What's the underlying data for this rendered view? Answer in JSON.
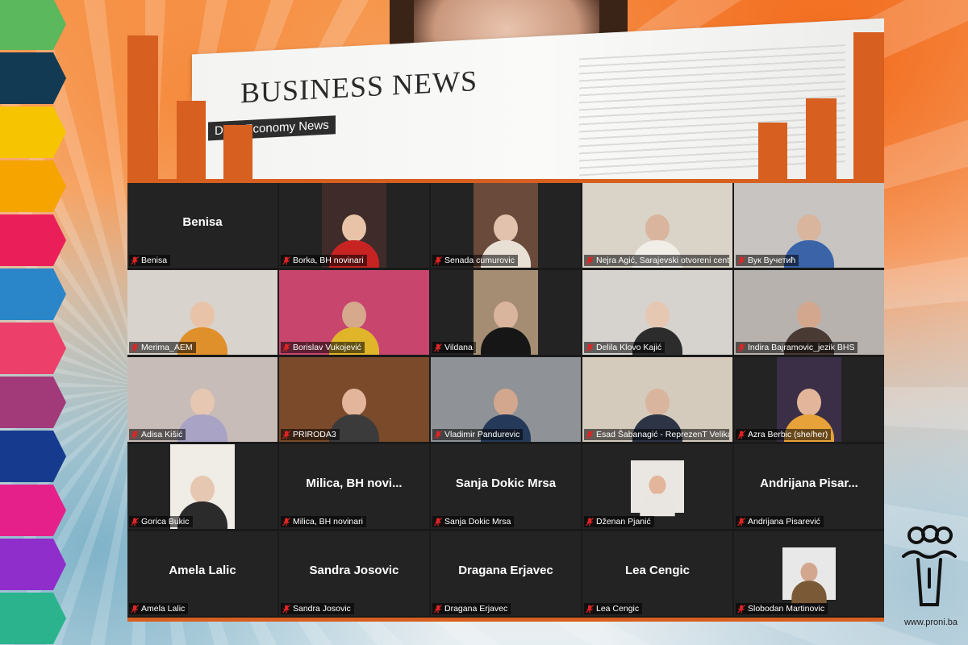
{
  "header": {
    "newspaper_title": "BUSINESS NEWS",
    "newspaper_tag": "Daily Economy News"
  },
  "brand": {
    "url": "www.proni.ba"
  },
  "colors": {
    "accent_orange": "#d75f1f",
    "active_speaker_border": "#c9e36a",
    "arrow_stack": [
      "#5cb85c",
      "#123a52",
      "#f6c400",
      "#f5a400",
      "#ea1f5a",
      "#2a86c8",
      "#ec3f6a",
      "#a23a7a",
      "#163b8e",
      "#e6208a",
      "#8f2ecb",
      "#2bb38e"
    ]
  },
  "participants": [
    {
      "label": "Benisa",
      "display_name": "Benisa",
      "video": false
    },
    {
      "label": "Borka, BH novinari",
      "video": true,
      "bg": "#3f2c2a",
      "shirt": "#c82323",
      "skin": "#e8c3a8"
    },
    {
      "label": "Senada cumurovic",
      "video": true,
      "bg": "#6a4a3a",
      "shirt": "#e8e0d5",
      "skin": "#e2c2ad"
    },
    {
      "label": "Nejra Agić, Sarajevski otvoreni centar",
      "video": true,
      "bg": "#d9d3c8",
      "shirt": "#f1eee8",
      "skin": "#d9b59d"
    },
    {
      "label": "Вук Вучетић",
      "video": true,
      "bg": "#c7c4c1",
      "shirt": "#3a63a8",
      "skin": "#d9b59d"
    },
    {
      "label": "Merima_AEM",
      "video": true,
      "active": true,
      "bg": "#d8d3cc",
      "shirt": "#e0902b",
      "skin": "#e8c3a8"
    },
    {
      "label": "Borislav Vukojević",
      "video": true,
      "bg": "#c8456d",
      "shirt": "#e0b52a",
      "skin": "#d6a88c"
    },
    {
      "label": "Vildana",
      "video": true,
      "bg": "#a58d73",
      "shirt": "#161616",
      "skin": "#d9b59d"
    },
    {
      "label": "Delila Klovo Kajić",
      "video": true,
      "bg": "#d6d3cf",
      "shirt": "#2c2c2c",
      "skin": "#e6c7b1"
    },
    {
      "label": "Indira Bajramovic_jezik BHS",
      "video": true,
      "bg": "#b7b2ae",
      "shirt": "#4a3a34",
      "skin": "#d3a78d"
    },
    {
      "label": "Adisa Kišić",
      "video": true,
      "bg": "#c8bcb8",
      "shirt": "#a9a3c5",
      "skin": "#e6c7b1"
    },
    {
      "label": "PRIRODA3",
      "video": true,
      "bg": "#7a4a2a",
      "shirt": "#3b3b3b",
      "skin": "#e3b59a"
    },
    {
      "label": "Vladimir Pandurevic",
      "video": true,
      "bg": "#8f9296",
      "shirt": "#253a5a",
      "skin": "#d3a78d"
    },
    {
      "label": "Esad Šabanagić - ReprezenT Velika Kladuša",
      "video": true,
      "bg": "#d4cbbd",
      "shirt": "#2c3446",
      "skin": "#d9b59d"
    },
    {
      "label": "Azra Berbic (she/her)",
      "video": true,
      "bg": "#3a2f46",
      "shirt": "#e8a23a",
      "skin": "#e3b59a"
    },
    {
      "label": "Gorica Bukic",
      "video": true,
      "bg": "#f0ece6",
      "shirt": "#2b2b2b",
      "skin": "#e6c7b1"
    },
    {
      "label": "Milica, BH novinari",
      "display_name": "Milica,  BH  novi...",
      "video": false
    },
    {
      "label": "Sanja Dokic Mrsa",
      "display_name": "Sanja Dokic Mrsa",
      "video": false
    },
    {
      "label": "Dženan Pjanić",
      "video": true,
      "bg": "#eae7e3",
      "shirt": "#e9e6e2",
      "skin": "#e3b59a"
    },
    {
      "label": "Andrijana Pisarević",
      "display_name": "Andrijana  Pisar...",
      "video": false
    },
    {
      "label": "Amela Lalic",
      "display_name": "Amela Lalic",
      "video": false
    },
    {
      "label": "Sandra Josovic",
      "display_name": "Sandra Josovic",
      "video": false
    },
    {
      "label": "Dragana Erjavec",
      "display_name": "Dragana Erjavec",
      "video": false
    },
    {
      "label": "Lea Cengic",
      "display_name": "Lea Cengic",
      "video": false
    },
    {
      "label": "Slobodan Martinovic",
      "video": true,
      "bg": "#e8e8e8",
      "shirt": "#7a5a36",
      "skin": "#d3a78d"
    }
  ]
}
